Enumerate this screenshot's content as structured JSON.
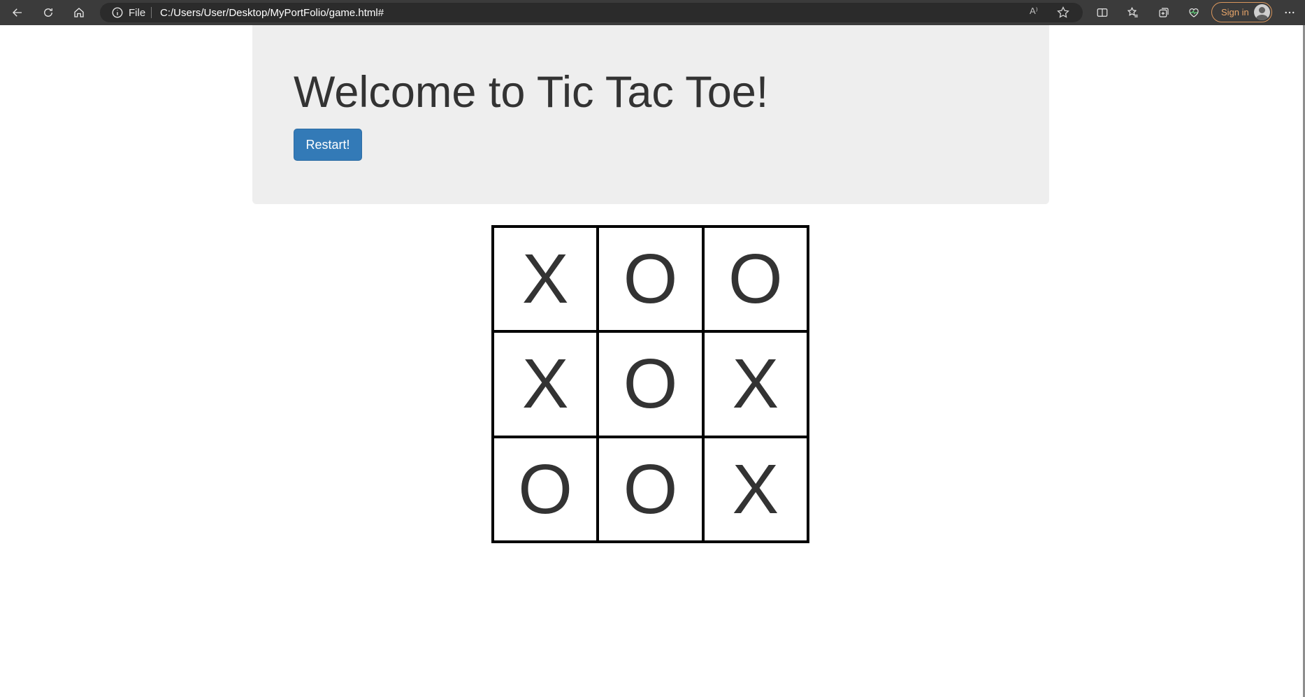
{
  "browser": {
    "address_prefix": "File",
    "url": "C:/Users/User/Desktop/MyPortFolio/game.html#",
    "sign_in_label": "Sign in",
    "read_aloud_glyph": "A⁾"
  },
  "page": {
    "title": "Welcome to Tic Tac Toe!",
    "restart_label": "Restart!",
    "accent_color": "#337ab7"
  },
  "board": {
    "cells": [
      "X",
      "O",
      "O",
      "X",
      "O",
      "X",
      "O",
      "O",
      "X"
    ]
  }
}
